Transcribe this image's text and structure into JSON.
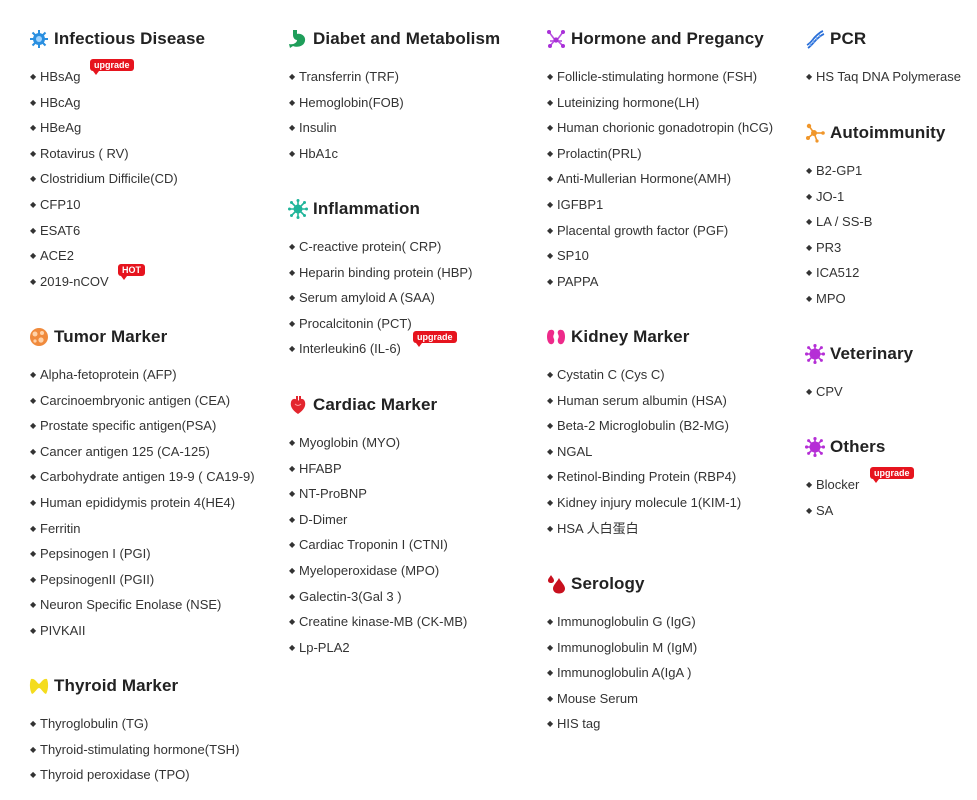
{
  "colors": {
    "badge": "#e6141e"
  },
  "columns": [
    {
      "sections": [
        {
          "title": "Infectious Disease",
          "icon": "virus-icon",
          "items": [
            {
              "label": "HBsAg",
              "badge": "upgrade"
            },
            {
              "label": "HBcAg"
            },
            {
              "label": "HBeAg"
            },
            {
              "label": "Rotavirus ( RV)"
            },
            {
              "label": "Clostridium Difficile(CD)"
            },
            {
              "label": "CFP10"
            },
            {
              "label": "ESAT6"
            },
            {
              "label": "ACE2"
            },
            {
              "label": "2019-nCOV",
              "badge": "HOT"
            }
          ]
        },
        {
          "title": "Tumor Marker",
          "icon": "tumor-cell-icon",
          "items": [
            {
              "label": "Alpha-fetoprotein (AFP)"
            },
            {
              "label": "Carcinoembryonic antigen (CEA)"
            },
            {
              "label": "Prostate specific antigen(PSA)"
            },
            {
              "label": "Cancer antigen 125 (CA-125)"
            },
            {
              "label": "Carbohydrate antigen 19-9 ( CA19-9)"
            },
            {
              "label": "Human epididymis protein 4(HE4)"
            },
            {
              "label": "Ferritin"
            },
            {
              "label": "Pepsinogen I (PGI)"
            },
            {
              "label": "PepsinogenII (PGII)"
            },
            {
              "label": "Neuron Specific Enolase (NSE)"
            },
            {
              "label": "PIVKAII"
            }
          ]
        },
        {
          "title": "Thyroid Marker",
          "icon": "thyroid-icon",
          "items": [
            {
              "label": "Thyroglobulin (TG)"
            },
            {
              "label": "Thyroid-stimulating hormone(TSH)"
            },
            {
              "label": "Thyroid peroxidase (TPO)"
            }
          ]
        }
      ]
    },
    {
      "sections": [
        {
          "title": "Diabet and Metabolism",
          "icon": "stomach-icon",
          "items": [
            {
              "label": "Transferrin (TRF)"
            },
            {
              "label": "Hemoglobin(FOB)"
            },
            {
              "label": "Insulin"
            },
            {
              "label": "HbA1c"
            }
          ]
        },
        {
          "title": "Inflammation",
          "icon": "inflammation-icon",
          "items": [
            {
              "label": "C-reactive protein( CRP)"
            },
            {
              "label": "Heparin binding protein (HBP)"
            },
            {
              "label": "Serum amyloid A (SAA)"
            },
            {
              "label": "Procalcitonin (PCT)"
            },
            {
              "label": "Interleukin6 (IL-6)",
              "badge": "upgrade"
            }
          ]
        },
        {
          "title": "Cardiac Marker",
          "icon": "heart-icon",
          "items": [
            {
              "label": "Myoglobin (MYO)"
            },
            {
              "label": "HFABP"
            },
            {
              "label": "NT-ProBNP"
            },
            {
              "label": "D-Dimer"
            },
            {
              "label": "Cardiac Troponin I (CTNI)"
            },
            {
              "label": "Myeloperoxidase (MPO)"
            },
            {
              "label": "Galectin-3(Gal 3 )"
            },
            {
              "label": "Creatine kinase-MB (CK-MB)"
            },
            {
              "label": "Lp-PLA2"
            }
          ]
        }
      ]
    },
    {
      "sections": [
        {
          "title": "Hormone and Pregancy",
          "icon": "molecule-icon",
          "items": [
            {
              "label": "Follicle-stimulating hormone (FSH)"
            },
            {
              "label": "Luteinizing hormone(LH)"
            },
            {
              "label": "Human chorionic gonadotropin (hCG)"
            },
            {
              "label": "Prolactin(PRL)"
            },
            {
              "label": "Anti-Mullerian Hormone(AMH)"
            },
            {
              "label": "IGFBP1"
            },
            {
              "label": "Placental growth factor (PGF)"
            },
            {
              "label": "SP10"
            },
            {
              "label": "PAPPA"
            }
          ]
        },
        {
          "title": "Kidney Marker",
          "icon": "kidney-icon",
          "items": [
            {
              "label": "Cystatin C (Cys C)"
            },
            {
              "label": "Human serum albumin (HSA)"
            },
            {
              "label": "Beta-2 Microglobulin (B2-MG)"
            },
            {
              "label": "NGAL"
            },
            {
              "label": "Retinol-Binding Protein (RBP4)"
            },
            {
              "label": "Kidney injury molecule 1(KIM-1)"
            },
            {
              "label": "HSA 人白蛋白"
            }
          ]
        },
        {
          "title": "Serology",
          "icon": "blood-drop-icon",
          "items": [
            {
              "label": "Immunoglobulin G (IgG)"
            },
            {
              "label": "Immunoglobulin M (IgM)"
            },
            {
              "label": "Immunoglobulin A(IgA )"
            },
            {
              "label": "Mouse Serum"
            },
            {
              "label": "HIS tag"
            }
          ]
        }
      ]
    },
    {
      "sections": [
        {
          "title": "PCR",
          "icon": "dna-icon",
          "items": [
            {
              "label": "HS Taq DNA Polymerase"
            }
          ]
        },
        {
          "title": "Autoimmunity",
          "icon": "network-icon",
          "items": [
            {
              "label": "B2-GP1"
            },
            {
              "label": "JO-1"
            },
            {
              "label": "LA / SS-B"
            },
            {
              "label": "PR3"
            },
            {
              "label": "ICA512"
            },
            {
              "label": "MPO"
            }
          ]
        },
        {
          "title": "Veterinary",
          "icon": "virus-purple-icon",
          "items": [
            {
              "label": "CPV"
            }
          ]
        },
        {
          "title": "Others",
          "icon": "virus-purple-icon",
          "items": [
            {
              "label": "Blocker",
              "badge": "upgrade"
            },
            {
              "label": "SA"
            }
          ]
        }
      ]
    }
  ]
}
